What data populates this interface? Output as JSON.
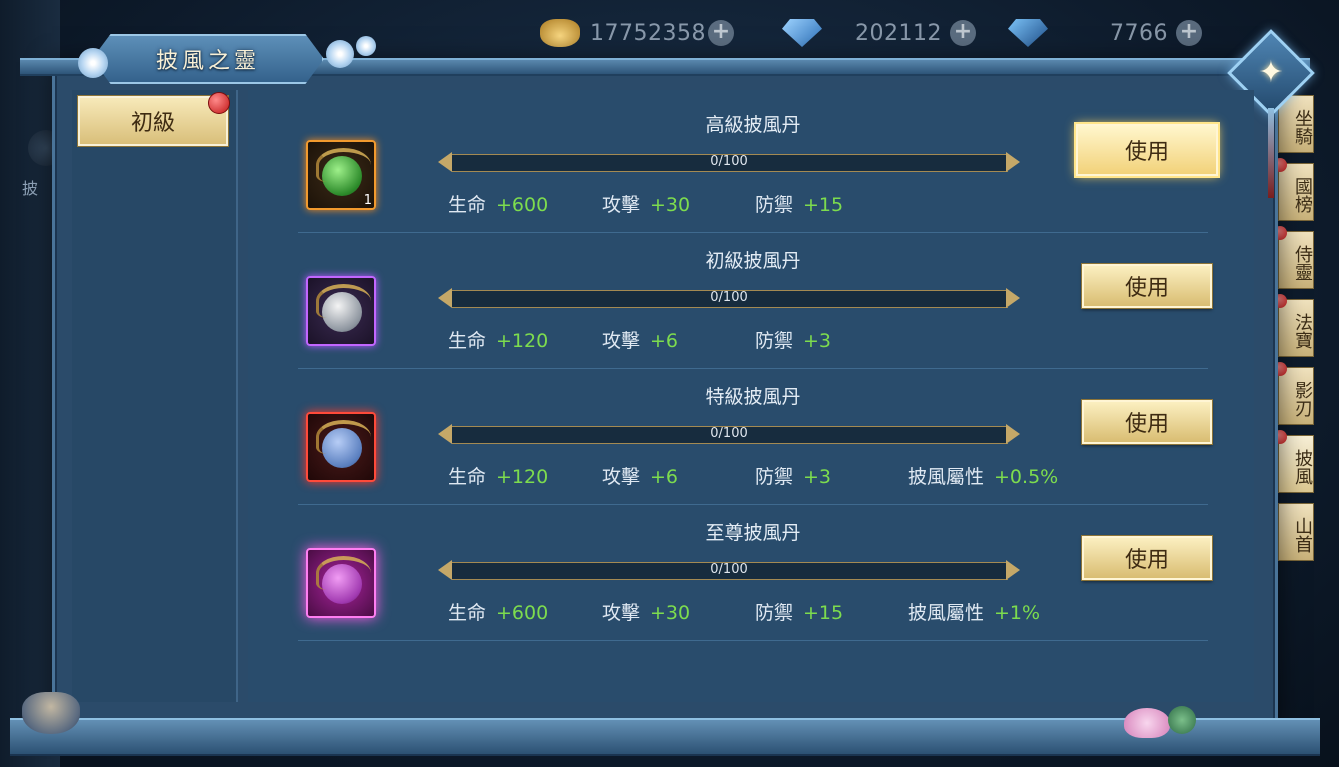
{
  "title": "披風之靈",
  "currencies": [
    {
      "icon": "gold-ingot-icon",
      "value": "17752358",
      "plus": "+"
    },
    {
      "icon": "diamond-icon",
      "value": "202112",
      "plus": "+"
    },
    {
      "icon": "locked-diamond-icon",
      "value": "7766",
      "plus": "+"
    }
  ],
  "background": {
    "left_label": "披",
    "side_tabs": [
      "坐騎",
      "國榜",
      "侍靈",
      "法寶",
      "影刃",
      "披風",
      "山首"
    ]
  },
  "category": {
    "label": "初級"
  },
  "items": [
    {
      "name": "高級披風丹",
      "frame": "orange",
      "count": "1",
      "progress_text": "0/100",
      "progress": 0,
      "stats": [
        {
          "key": "生命",
          "value": "+600"
        },
        {
          "key": "攻擊",
          "value": "+30"
        },
        {
          "key": "防禦",
          "value": "+15"
        }
      ],
      "button": "使用"
    },
    {
      "name": "初級披風丹",
      "frame": "purple",
      "progress_text": "0/100",
      "progress": 0,
      "stats": [
        {
          "key": "生命",
          "value": "+120"
        },
        {
          "key": "攻擊",
          "value": "+6"
        },
        {
          "key": "防禦",
          "value": "+3"
        }
      ],
      "button": "使用"
    },
    {
      "name": "特級披風丹",
      "frame": "red",
      "progress_text": "0/100",
      "progress": 0,
      "stats": [
        {
          "key": "生命",
          "value": "+120"
        },
        {
          "key": "攻擊",
          "value": "+6"
        },
        {
          "key": "防禦",
          "value": "+3"
        },
        {
          "key": "披風屬性",
          "value": "+0.5%"
        }
      ],
      "button": "使用"
    },
    {
      "name": "至尊披風丹",
      "frame": "magenta",
      "progress_text": "0/100",
      "progress": 0,
      "stats": [
        {
          "key": "生命",
          "value": "+600"
        },
        {
          "key": "攻擊",
          "value": "+30"
        },
        {
          "key": "防禦",
          "value": "+15"
        },
        {
          "key": "披風屬性",
          "value": "+1%"
        }
      ],
      "button": "使用"
    }
  ]
}
